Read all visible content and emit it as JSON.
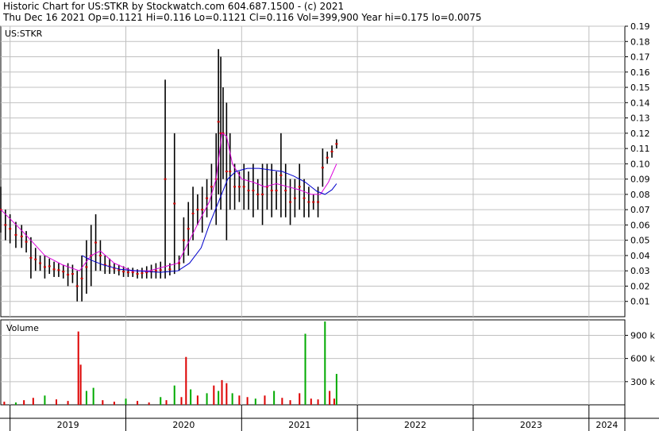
{
  "header": {
    "line1": "Historic Chart for US:STKR by Stockwatch.com 604.687.1500 - (c) 2021",
    "line2": "Thu Dec 16 2021  Op=0.1121  Hi=0.116  Lo=0.1121  Cl=0.116  Vol=399,900  Year hi=0.175  lo=0.0075"
  },
  "colors": {
    "price_bar": "#000000",
    "price_close_marker": "#cc0000",
    "ma_short": "#dd00dd",
    "ma_long": "#0000cc",
    "volume_up": "#00aa00",
    "volume_down": "#dd0000",
    "grid": "#c0c0c0"
  },
  "chart_data": [
    {
      "type": "line",
      "title": "US:STKR",
      "y_axis_side": "right",
      "ylim": [
        0,
        0.19
      ],
      "y_ticks": [
        "0.01",
        "0.02",
        "0.03",
        "0.04",
        "0.05",
        "0.06",
        "0.07",
        "0.08",
        "0.09",
        "0.10",
        "0.11",
        "0.12",
        "0.13",
        "0.14",
        "0.15",
        "0.16",
        "0.17",
        "0.18",
        "0.19"
      ],
      "x_tick_labels": [
        "2019",
        "2020",
        "2021",
        "2022",
        "2023",
        "2024"
      ],
      "grid": true,
      "series": [
        {
          "kind": "price_hi_lo",
          "points": [
            {
              "t": 2018.92,
              "hi": 0.085,
              "lo": 0.055
            },
            {
              "t": 2018.96,
              "hi": 0.07,
              "lo": 0.05
            },
            {
              "t": 2019.0,
              "hi": 0.067,
              "lo": 0.048
            },
            {
              "t": 2019.05,
              "hi": 0.062,
              "lo": 0.045
            },
            {
              "t": 2019.1,
              "hi": 0.06,
              "lo": 0.045
            },
            {
              "t": 2019.14,
              "hi": 0.056,
              "lo": 0.042
            },
            {
              "t": 2019.18,
              "hi": 0.052,
              "lo": 0.025
            },
            {
              "t": 2019.22,
              "hi": 0.045,
              "lo": 0.03
            },
            {
              "t": 2019.26,
              "hi": 0.04,
              "lo": 0.03
            },
            {
              "t": 2019.3,
              "hi": 0.04,
              "lo": 0.025
            },
            {
              "t": 2019.34,
              "hi": 0.038,
              "lo": 0.028
            },
            {
              "t": 2019.38,
              "hi": 0.036,
              "lo": 0.026
            },
            {
              "t": 2019.42,
              "hi": 0.035,
              "lo": 0.026
            },
            {
              "t": 2019.46,
              "hi": 0.034,
              "lo": 0.025
            },
            {
              "t": 2019.5,
              "hi": 0.035,
              "lo": 0.02
            },
            {
              "t": 2019.54,
              "hi": 0.034,
              "lo": 0.022
            },
            {
              "t": 2019.58,
              "hi": 0.03,
              "lo": 0.01
            },
            {
              "t": 2019.62,
              "hi": 0.04,
              "lo": 0.01
            },
            {
              "t": 2019.66,
              "hi": 0.05,
              "lo": 0.015
            },
            {
              "t": 2019.7,
              "hi": 0.06,
              "lo": 0.02
            },
            {
              "t": 2019.74,
              "hi": 0.067,
              "lo": 0.03
            },
            {
              "t": 2019.78,
              "hi": 0.05,
              "lo": 0.03
            },
            {
              "t": 2019.82,
              "hi": 0.04,
              "lo": 0.028
            },
            {
              "t": 2019.86,
              "hi": 0.038,
              "lo": 0.028
            },
            {
              "t": 2019.9,
              "hi": 0.035,
              "lo": 0.028
            },
            {
              "t": 2019.94,
              "hi": 0.034,
              "lo": 0.027
            },
            {
              "t": 2019.98,
              "hi": 0.033,
              "lo": 0.026
            },
            {
              "t": 2020.02,
              "hi": 0.032,
              "lo": 0.026
            },
            {
              "t": 2020.06,
              "hi": 0.032,
              "lo": 0.026
            },
            {
              "t": 2020.1,
              "hi": 0.031,
              "lo": 0.025
            },
            {
              "t": 2020.14,
              "hi": 0.032,
              "lo": 0.025
            },
            {
              "t": 2020.18,
              "hi": 0.033,
              "lo": 0.025
            },
            {
              "t": 2020.22,
              "hi": 0.034,
              "lo": 0.025
            },
            {
              "t": 2020.26,
              "hi": 0.035,
              "lo": 0.025
            },
            {
              "t": 2020.3,
              "hi": 0.036,
              "lo": 0.025
            },
            {
              "t": 2020.34,
              "hi": 0.155,
              "lo": 0.025
            },
            {
              "t": 2020.38,
              "hi": 0.035,
              "lo": 0.027
            },
            {
              "t": 2020.42,
              "hi": 0.12,
              "lo": 0.028
            },
            {
              "t": 2020.46,
              "hi": 0.04,
              "lo": 0.03
            },
            {
              "t": 2020.5,
              "hi": 0.065,
              "lo": 0.035
            },
            {
              "t": 2020.54,
              "hi": 0.075,
              "lo": 0.04
            },
            {
              "t": 2020.58,
              "hi": 0.085,
              "lo": 0.05
            },
            {
              "t": 2020.62,
              "hi": 0.08,
              "lo": 0.06
            },
            {
              "t": 2020.66,
              "hi": 0.085,
              "lo": 0.055
            },
            {
              "t": 2020.7,
              "hi": 0.09,
              "lo": 0.065
            },
            {
              "t": 2020.74,
              "hi": 0.1,
              "lo": 0.07
            },
            {
              "t": 2020.78,
              "hi": 0.12,
              "lo": 0.06
            },
            {
              "t": 2020.8,
              "hi": 0.175,
              "lo": 0.08
            },
            {
              "t": 2020.82,
              "hi": 0.17,
              "lo": 0.07
            },
            {
              "t": 2020.84,
              "hi": 0.15,
              "lo": 0.09
            },
            {
              "t": 2020.87,
              "hi": 0.14,
              "lo": 0.05
            },
            {
              "t": 2020.9,
              "hi": 0.12,
              "lo": 0.07
            },
            {
              "t": 2020.94,
              "hi": 0.1,
              "lo": 0.07
            },
            {
              "t": 2020.98,
              "hi": 0.095,
              "lo": 0.075
            },
            {
              "t": 2021.02,
              "hi": 0.1,
              "lo": 0.07
            },
            {
              "t": 2021.06,
              "hi": 0.095,
              "lo": 0.07
            },
            {
              "t": 2021.1,
              "hi": 0.1,
              "lo": 0.065
            },
            {
              "t": 2021.14,
              "hi": 0.09,
              "lo": 0.07
            },
            {
              "t": 2021.18,
              "hi": 0.1,
              "lo": 0.06
            },
            {
              "t": 2021.22,
              "hi": 0.1,
              "lo": 0.07
            },
            {
              "t": 2021.26,
              "hi": 0.1,
              "lo": 0.065
            },
            {
              "t": 2021.3,
              "hi": 0.095,
              "lo": 0.07
            },
            {
              "t": 2021.34,
              "hi": 0.12,
              "lo": 0.065
            },
            {
              "t": 2021.38,
              "hi": 0.1,
              "lo": 0.065
            },
            {
              "t": 2021.42,
              "hi": 0.09,
              "lo": 0.06
            },
            {
              "t": 2021.46,
              "hi": 0.09,
              "lo": 0.065
            },
            {
              "t": 2021.5,
              "hi": 0.1,
              "lo": 0.07
            },
            {
              "t": 2021.54,
              "hi": 0.09,
              "lo": 0.065
            },
            {
              "t": 2021.58,
              "hi": 0.085,
              "lo": 0.065
            },
            {
              "t": 2021.62,
              "hi": 0.08,
              "lo": 0.07
            },
            {
              "t": 2021.66,
              "hi": 0.085,
              "lo": 0.065
            },
            {
              "t": 2021.7,
              "hi": 0.11,
              "lo": 0.085
            },
            {
              "t": 2021.74,
              "hi": 0.108,
              "lo": 0.1
            },
            {
              "t": 2021.78,
              "hi": 0.112,
              "lo": 0.104
            },
            {
              "t": 2021.82,
              "hi": 0.116,
              "lo": 0.11
            }
          ]
        },
        {
          "name": "MA short",
          "kind": "moving_average",
          "points": [
            {
              "t": 2018.92,
              "v": 0.07
            },
            {
              "t": 2019.0,
              "v": 0.064
            },
            {
              "t": 2019.08,
              "v": 0.058
            },
            {
              "t": 2019.18,
              "v": 0.05
            },
            {
              "t": 2019.3,
              "v": 0.04
            },
            {
              "t": 2019.45,
              "v": 0.034
            },
            {
              "t": 2019.6,
              "v": 0.03
            },
            {
              "t": 2019.7,
              "v": 0.04
            },
            {
              "t": 2019.78,
              "v": 0.043
            },
            {
              "t": 2019.9,
              "v": 0.035
            },
            {
              "t": 2020.05,
              "v": 0.03
            },
            {
              "t": 2020.2,
              "v": 0.03
            },
            {
              "t": 2020.35,
              "v": 0.033
            },
            {
              "t": 2020.45,
              "v": 0.035
            },
            {
              "t": 2020.55,
              "v": 0.05
            },
            {
              "t": 2020.65,
              "v": 0.065
            },
            {
              "t": 2020.72,
              "v": 0.075
            },
            {
              "t": 2020.78,
              "v": 0.09
            },
            {
              "t": 2020.83,
              "v": 0.12
            },
            {
              "t": 2020.87,
              "v": 0.118
            },
            {
              "t": 2020.92,
              "v": 0.1
            },
            {
              "t": 2021.0,
              "v": 0.09
            },
            {
              "t": 2021.1,
              "v": 0.088
            },
            {
              "t": 2021.2,
              "v": 0.085
            },
            {
              "t": 2021.3,
              "v": 0.087
            },
            {
              "t": 2021.4,
              "v": 0.085
            },
            {
              "t": 2021.5,
              "v": 0.083
            },
            {
              "t": 2021.6,
              "v": 0.08
            },
            {
              "t": 2021.68,
              "v": 0.08
            },
            {
              "t": 2021.75,
              "v": 0.088
            },
            {
              "t": 2021.82,
              "v": 0.1
            }
          ]
        },
        {
          "name": "MA long",
          "kind": "moving_average",
          "points": [
            {
              "t": 2019.62,
              "v": 0.04
            },
            {
              "t": 2019.7,
              "v": 0.037
            },
            {
              "t": 2019.8,
              "v": 0.034
            },
            {
              "t": 2019.95,
              "v": 0.031
            },
            {
              "t": 2020.1,
              "v": 0.03
            },
            {
              "t": 2020.3,
              "v": 0.029
            },
            {
              "t": 2020.45,
              "v": 0.03
            },
            {
              "t": 2020.55,
              "v": 0.035
            },
            {
              "t": 2020.65,
              "v": 0.045
            },
            {
              "t": 2020.72,
              "v": 0.06
            },
            {
              "t": 2020.8,
              "v": 0.075
            },
            {
              "t": 2020.88,
              "v": 0.09
            },
            {
              "t": 2020.95,
              "v": 0.095
            },
            {
              "t": 2021.05,
              "v": 0.097
            },
            {
              "t": 2021.15,
              "v": 0.097
            },
            {
              "t": 2021.25,
              "v": 0.096
            },
            {
              "t": 2021.35,
              "v": 0.095
            },
            {
              "t": 2021.45,
              "v": 0.092
            },
            {
              "t": 2021.55,
              "v": 0.088
            },
            {
              "t": 2021.65,
              "v": 0.082
            },
            {
              "t": 2021.72,
              "v": 0.08
            },
            {
              "t": 2021.78,
              "v": 0.083
            },
            {
              "t": 2021.82,
              "v": 0.087
            }
          ]
        }
      ]
    },
    {
      "type": "bar",
      "title": "Volume",
      "y_axis_side": "right",
      "ylim": [
        0,
        1100000
      ],
      "y_tick_labels": [
        "300 k",
        "600 k",
        "900 k"
      ],
      "y_tick_values": [
        300000,
        600000,
        900000
      ],
      "series": [
        {
          "kind": "volume",
          "points": [
            {
              "t": 2018.95,
              "v": 40000,
              "up": false
            },
            {
              "t": 2019.05,
              "v": 30000,
              "up": true
            },
            {
              "t": 2019.12,
              "v": 60000,
              "up": false
            },
            {
              "t": 2019.2,
              "v": 90000,
              "up": false
            },
            {
              "t": 2019.3,
              "v": 120000,
              "up": true
            },
            {
              "t": 2019.4,
              "v": 70000,
              "up": false
            },
            {
              "t": 2019.5,
              "v": 50000,
              "up": false
            },
            {
              "t": 2019.59,
              "v": 950000,
              "up": false
            },
            {
              "t": 2019.61,
              "v": 520000,
              "up": false
            },
            {
              "t": 2019.66,
              "v": 180000,
              "up": true
            },
            {
              "t": 2019.72,
              "v": 220000,
              "up": true
            },
            {
              "t": 2019.8,
              "v": 60000,
              "up": false
            },
            {
              "t": 2019.9,
              "v": 40000,
              "up": false
            },
            {
              "t": 2020.0,
              "v": 80000,
              "up": true
            },
            {
              "t": 2020.1,
              "v": 50000,
              "up": false
            },
            {
              "t": 2020.2,
              "v": 30000,
              "up": false
            },
            {
              "t": 2020.3,
              "v": 100000,
              "up": true
            },
            {
              "t": 2020.35,
              "v": 60000,
              "up": false
            },
            {
              "t": 2020.42,
              "v": 250000,
              "up": true
            },
            {
              "t": 2020.48,
              "v": 100000,
              "up": false
            },
            {
              "t": 2020.52,
              "v": 620000,
              "up": false
            },
            {
              "t": 2020.56,
              "v": 200000,
              "up": true
            },
            {
              "t": 2020.62,
              "v": 120000,
              "up": false
            },
            {
              "t": 2020.7,
              "v": 150000,
              "up": true
            },
            {
              "t": 2020.76,
              "v": 250000,
              "up": false
            },
            {
              "t": 2020.8,
              "v": 180000,
              "up": true
            },
            {
              "t": 2020.83,
              "v": 320000,
              "up": false
            },
            {
              "t": 2020.87,
              "v": 280000,
              "up": false
            },
            {
              "t": 2020.92,
              "v": 150000,
              "up": true
            },
            {
              "t": 2020.98,
              "v": 120000,
              "up": false
            },
            {
              "t": 2021.05,
              "v": 100000,
              "up": false
            },
            {
              "t": 2021.12,
              "v": 80000,
              "up": true
            },
            {
              "t": 2021.2,
              "v": 120000,
              "up": false
            },
            {
              "t": 2021.28,
              "v": 180000,
              "up": true
            },
            {
              "t": 2021.35,
              "v": 90000,
              "up": false
            },
            {
              "t": 2021.42,
              "v": 60000,
              "up": false
            },
            {
              "t": 2021.5,
              "v": 150000,
              "up": false
            },
            {
              "t": 2021.55,
              "v": 920000,
              "up": true
            },
            {
              "t": 2021.6,
              "v": 80000,
              "up": false
            },
            {
              "t": 2021.66,
              "v": 70000,
              "up": false
            },
            {
              "t": 2021.72,
              "v": 1080000,
              "up": true
            },
            {
              "t": 2021.76,
              "v": 180000,
              "up": false
            },
            {
              "t": 2021.8,
              "v": 80000,
              "up": false
            },
            {
              "t": 2021.82,
              "v": 400000,
              "up": true
            }
          ]
        }
      ]
    }
  ]
}
